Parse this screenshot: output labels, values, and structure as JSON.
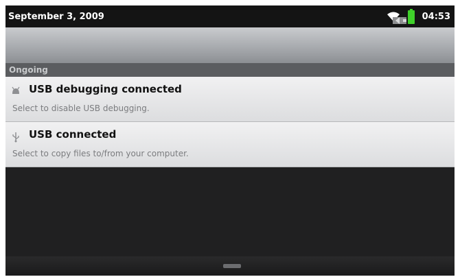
{
  "status_bar": {
    "date": "September 3, 2009",
    "time": "04:53",
    "icons": [
      "wifi-icon",
      "battery-icon",
      "notification-icon",
      "notification-icon"
    ],
    "battery_color": "#3fd12a"
  },
  "section": {
    "label": "Ongoing"
  },
  "notifications": [
    {
      "icon": "usb-debugging-icon",
      "title": "USB debugging connected",
      "description": "Select to disable USB debugging."
    },
    {
      "icon": "usb-icon",
      "title": "USB connected",
      "description": "Select to copy files to/from your computer."
    }
  ]
}
